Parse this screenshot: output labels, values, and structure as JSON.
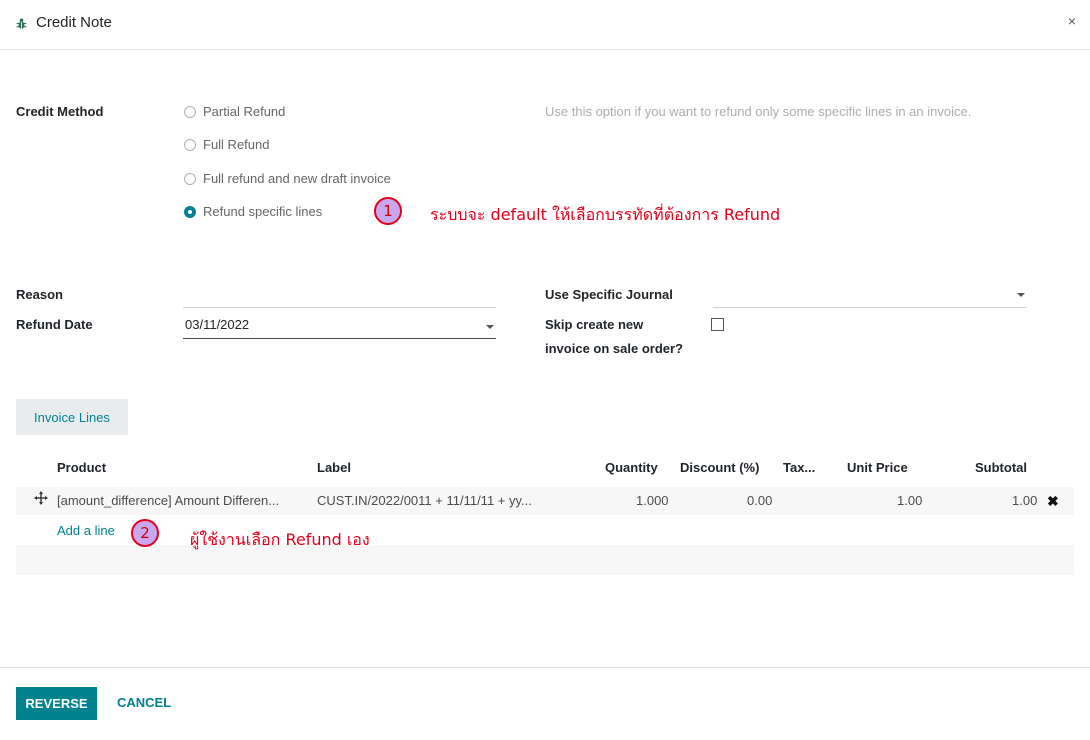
{
  "dialog": {
    "title": "Credit Note",
    "close_label": "×"
  },
  "credit_method": {
    "label": "Credit Method",
    "options": [
      {
        "label": "Partial Refund",
        "checked": false
      },
      {
        "label": "Full Refund",
        "checked": false
      },
      {
        "label": "Full refund and new draft invoice",
        "checked": false
      },
      {
        "label": "Refund specific lines",
        "checked": true
      }
    ],
    "help_text": "Use this option if you want to refund only some specific lines in an invoice."
  },
  "annotations": [
    {
      "number": "1",
      "text": "ระบบจะ default ให้เลือกบรรทัดที่ต้องการ Refund"
    },
    {
      "number": "2",
      "text": "ผู้ใช้งานเลือก Refund เอง"
    }
  ],
  "form": {
    "reason_label": "Reason",
    "reason_value": "",
    "refund_date_label": "Refund Date",
    "refund_date_value": "03/11/2022",
    "journal_label": "Use Specific Journal",
    "journal_value": "",
    "skip_label_1": "Skip create new",
    "skip_label_2": "invoice on sale order?",
    "skip_checked": false
  },
  "tabs": [
    {
      "label": "Invoice Lines",
      "active": true
    }
  ],
  "table": {
    "columns": [
      "Product",
      "Label",
      "Quantity",
      "Discount (%)",
      "Tax...",
      "Unit Price",
      "Subtotal"
    ],
    "rows": [
      {
        "product": "[amount_difference] Amount Differen...",
        "label": "CUST.IN/2022/0011 + 11/11/11 + yy...",
        "quantity": "1.000",
        "discount": "0.00",
        "tax": "",
        "unit_price": "1.00",
        "subtotal": "1.00"
      }
    ],
    "add_line_label": "Add a line"
  },
  "footer": {
    "primary_label": "REVERSE",
    "secondary_label": "CANCEL"
  },
  "colors": {
    "accent": "#00838f",
    "annotation": "#e0001b",
    "badge_fill": "#c9a7ef"
  }
}
